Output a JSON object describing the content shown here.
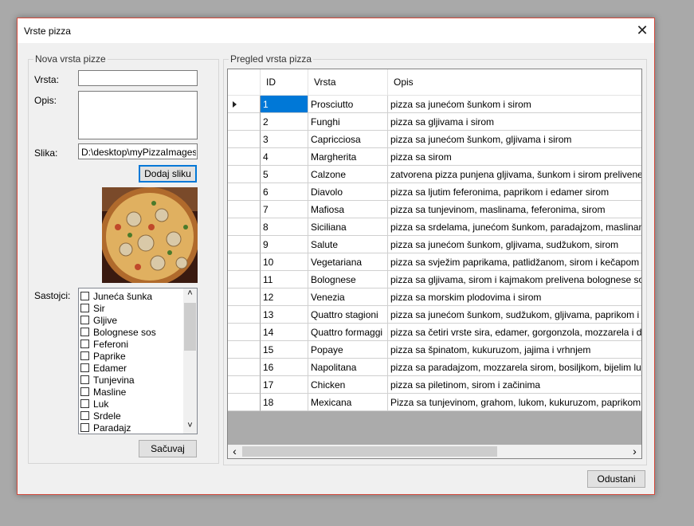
{
  "window": {
    "title": "Vrste pizza",
    "close_glyph": "✕"
  },
  "new_pizza": {
    "legend": "Nova vrsta pizze",
    "vrsta_label": "Vrsta:",
    "vrsta_value": "",
    "opis_label": "Opis:",
    "opis_value": "",
    "slika_label": "Slika:",
    "slika_value": "D:\\desktop\\myPizzaImages\\bo",
    "add_image_button": "Dodaj sliku",
    "sastojci_label": "Sastojci:",
    "ingredients": [
      "Juneća šunka",
      "Sir",
      "Gljive",
      "Bolognese sos",
      "Feferoni",
      "Paprike",
      "Edamer",
      "Tunjevina",
      "Masline",
      "Luk",
      "Srdele",
      "Paradajz"
    ],
    "save_button": "Sačuvaj"
  },
  "overview": {
    "legend": "Pregled vrsta pizza",
    "columns": [
      "ID",
      "Vrsta",
      "Opis"
    ],
    "rows": [
      [
        "1",
        "Prosciutto",
        "pizza sa junećom šunkom i sirom"
      ],
      [
        "2",
        "Funghi",
        "pizza sa gljivama i sirom"
      ],
      [
        "3",
        "Capricciosa",
        "pizza sa junećom šunkom, gljivama i sirom"
      ],
      [
        "4",
        "Margherita",
        "pizza sa sirom"
      ],
      [
        "5",
        "Calzone",
        "zatvorena pizza punjena gljivama, šunkom i sirom prelivene bolognese"
      ],
      [
        "6",
        "Diavolo",
        "pizza sa ljutim feferonima, paprikom i edamer sirom"
      ],
      [
        "7",
        "Mafiosa",
        "pizza sa tunjevinom, maslinama, feferonima, sirom"
      ],
      [
        "8",
        "Siciliana",
        "pizza sa srdelama, junećom šunkom, paradajzom, maslinama i sirom"
      ],
      [
        "9",
        "Salute",
        "pizza sa junećom šunkom, gljivama, sudžukom, sirom"
      ],
      [
        "10",
        "Vegetariana",
        "pizza sa svježim paprikama, patlidžanom, sirom i kečapom"
      ],
      [
        "11",
        "Bolognese",
        "pizza sa gljivama, sirom i kajmakom prelivena bolognese sosom"
      ],
      [
        "12",
        "Venezia",
        "pizza sa morskim plodovima i sirom"
      ],
      [
        "13",
        "Quattro stagioni",
        "pizza sa junećom šunkom, sudžukom, gljivama, paprikom i sirom"
      ],
      [
        "14",
        "Quattro formaggi",
        "pizza sa četiri vrste sira, edamer, gorgonzola, mozzarela i dimljeni sir"
      ],
      [
        "15",
        "Popaye",
        "pizza sa špinatom, kukuruzom, jajima i vrhnjem"
      ],
      [
        "16",
        "Napolitana",
        "pizza sa paradajzom, mozzarela sirom, bosiljkom, bijelim lukom i masl"
      ],
      [
        "17",
        "Chicken",
        "pizza sa piletinom, sirom i začinima"
      ],
      [
        "18",
        "Mexicana",
        "Pizza sa tunjevinom, grahom, lukom, kukuruzom, paprikom i feferoni"
      ]
    ],
    "selected_row": 0
  },
  "cancel_button": "Odustani",
  "icons": {
    "row_pointer": "row-pointer-icon",
    "scroll_left": "‹",
    "scroll_right": "›",
    "scroll_up": "˄",
    "scroll_down": "˅"
  },
  "colors": {
    "selection": "#0078d7",
    "window_border": "#d44a3c",
    "focus": "#0078d7"
  }
}
